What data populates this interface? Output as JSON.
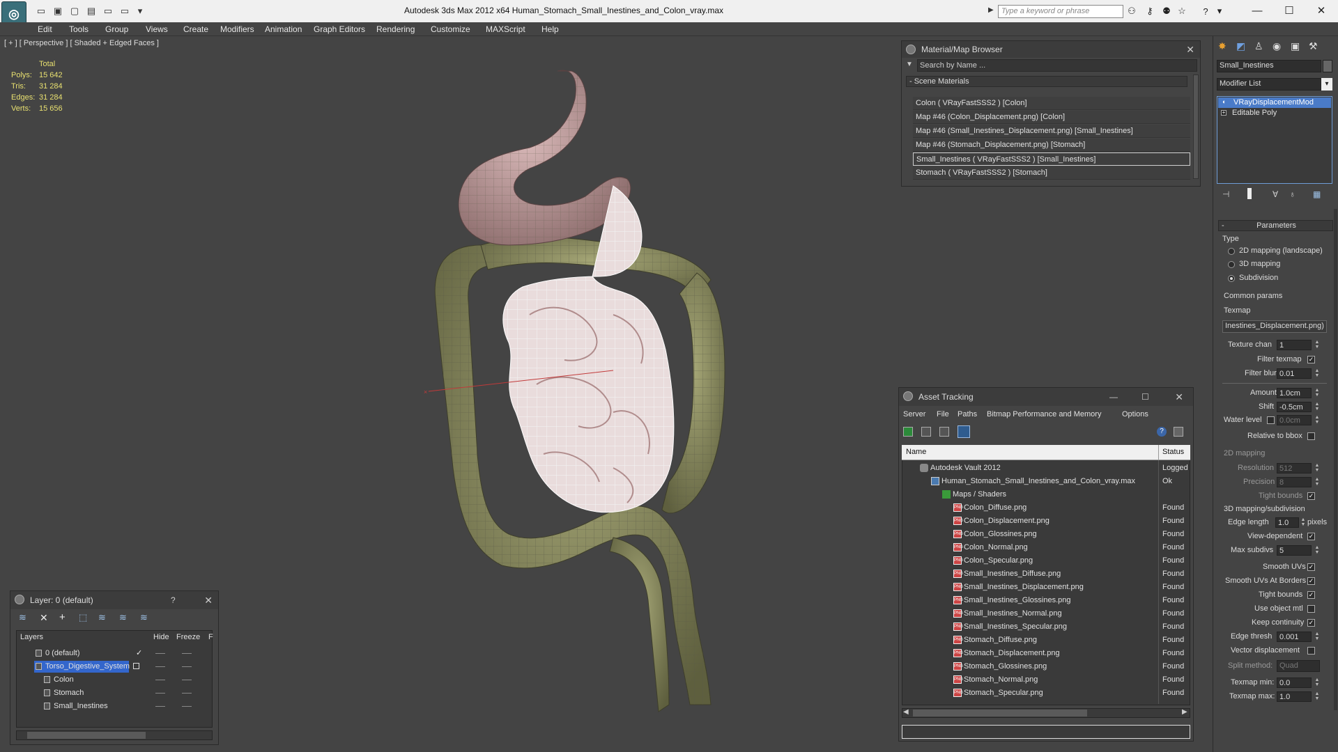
{
  "titlebar": {
    "title": "Autodesk 3ds Max  2012 x64      Human_Stomach_Small_Inestines_and_Colon_vray.max",
    "search_placeholder": "Type a keyword or phrase",
    "minimize": "—",
    "maximize": "☐",
    "close": "✕"
  },
  "menu": [
    "Edit",
    "Tools",
    "Group",
    "Views",
    "Create",
    "Modifiers",
    "Animation",
    "Graph Editors",
    "Rendering",
    "Customize",
    "MAXScript",
    "Help"
  ],
  "viewport": {
    "label": "[ + ] [ Perspective ] [ Shaded + Edged Faces ]",
    "stats_header": "Total",
    "stats": [
      {
        "label": "Polys:",
        "value": "15 642"
      },
      {
        "label": "Tris:",
        "value": "31 284"
      },
      {
        "label": "Edges:",
        "value": "31 284"
      },
      {
        "label": "Verts:",
        "value": "15 656"
      }
    ]
  },
  "material_browser": {
    "title": "Material/Map Browser",
    "search_placeholder": "Search by Name ...",
    "section": "- Scene Materials",
    "items": [
      "Colon  ( VRayFastSSS2 )  [Colon]",
      "Map #46 (Colon_Displacement.png) [Colon]",
      "Map #46 (Small_Inestines_Displacement.png) [Small_Inestines]",
      "Map #46 (Stomach_Displacement.png) [Stomach]",
      "Small_Inestines  ( VRayFastSSS2 )  [Small_Inestines]",
      "Stomach  ( VRayFastSSS2 )  [Stomach]"
    ]
  },
  "asset_tracking": {
    "title": "Asset Tracking",
    "menu": [
      "Server",
      "File",
      "Paths",
      "Bitmap Performance and Memory",
      "Options"
    ],
    "columns": {
      "name": "Name",
      "status": "Status"
    },
    "rows": [
      {
        "name": "Autodesk Vault 2012",
        "status": "Logged",
        "indent": 0,
        "icon": "vault"
      },
      {
        "name": "Human_Stomach_Small_Inestines_and_Colon_vray.max",
        "status": "Ok",
        "indent": 1,
        "icon": "max"
      },
      {
        "name": "Maps / Shaders",
        "status": "",
        "indent": 2,
        "icon": "folder"
      },
      {
        "name": "Colon_Diffuse.png",
        "status": "Found",
        "indent": 3,
        "icon": "png"
      },
      {
        "name": "Colon_Displacement.png",
        "status": "Found",
        "indent": 3,
        "icon": "png"
      },
      {
        "name": "Colon_Glossines.png",
        "status": "Found",
        "indent": 3,
        "icon": "png"
      },
      {
        "name": "Colon_Normal.png",
        "status": "Found",
        "indent": 3,
        "icon": "png"
      },
      {
        "name": "Colon_Specular.png",
        "status": "Found",
        "indent": 3,
        "icon": "png"
      },
      {
        "name": "Small_Inestines_Diffuse.png",
        "status": "Found",
        "indent": 3,
        "icon": "png"
      },
      {
        "name": "Small_Inestines_Displacement.png",
        "status": "Found",
        "indent": 3,
        "icon": "png"
      },
      {
        "name": "Small_Inestines_Glossines.png",
        "status": "Found",
        "indent": 3,
        "icon": "png"
      },
      {
        "name": "Small_Inestines_Normal.png",
        "status": "Found",
        "indent": 3,
        "icon": "png"
      },
      {
        "name": "Small_Inestines_Specular.png",
        "status": "Found",
        "indent": 3,
        "icon": "png"
      },
      {
        "name": "Stomach_Diffuse.png",
        "status": "Found",
        "indent": 3,
        "icon": "png"
      },
      {
        "name": "Stomach_Displacement.png",
        "status": "Found",
        "indent": 3,
        "icon": "png"
      },
      {
        "name": "Stomach_Glossines.png",
        "status": "Found",
        "indent": 3,
        "icon": "png"
      },
      {
        "name": "Stomach_Normal.png",
        "status": "Found",
        "indent": 3,
        "icon": "png"
      },
      {
        "name": "Stomach_Specular.png",
        "status": "Found",
        "indent": 3,
        "icon": "png"
      }
    ]
  },
  "layers": {
    "title": "Layer: 0 (default)",
    "help": "?",
    "columns": [
      "Layers",
      "Hide",
      "Freeze",
      "F"
    ],
    "rows": [
      {
        "name": "0 (default)",
        "indent": 1,
        "selected": false,
        "current": true
      },
      {
        "name": "Torso_Digestive_System",
        "indent": 1,
        "selected": true,
        "current": false
      },
      {
        "name": "Colon",
        "indent": 2,
        "selected": false,
        "current": false
      },
      {
        "name": "Stomach",
        "indent": 2,
        "selected": false,
        "current": false
      },
      {
        "name": "Small_Inestines",
        "indent": 2,
        "selected": false,
        "current": false
      }
    ]
  },
  "command_panel": {
    "object_name": "Small_Inestines",
    "modifier_list": "Modifier List",
    "stack": [
      "VRayDisplacementMod",
      "Editable Poly"
    ],
    "parameters_title": "Parameters",
    "type_label": "Type",
    "type_options": [
      {
        "label": "2D mapping (landscape)",
        "on": false
      },
      {
        "label": "3D mapping",
        "on": false
      },
      {
        "label": "Subdivision",
        "on": true
      }
    ],
    "common_params": "Common params",
    "texmap_label": "Texmap",
    "texmap_value": "Inestines_Displacement.png)",
    "texture_chan_label": "Texture chan",
    "texture_chan": "1",
    "filter_texmap": "Filter texmap",
    "filter_blur_label": "Filter blur",
    "filter_blur": "0.01",
    "amount_label": "Amount",
    "amount": "1.0cm",
    "shift_label": "Shift",
    "shift": "-0.5cm",
    "water_level_label": "Water level",
    "water_level": "0.0cm",
    "relative_bbox": "Relative to bbox",
    "mapping_2d": "2D mapping",
    "resolution_label": "Resolution",
    "resolution": "512",
    "precision_label": "Precision",
    "precision": "8",
    "tight_bounds": "Tight bounds",
    "mapping_3d": "3D mapping/subdivision",
    "edge_length_label": "Edge length",
    "edge_length": "1.0",
    "pixels": "pixels",
    "view_dependent": "View-dependent",
    "max_subdivs_label": "Max subdivs",
    "max_subdivs": "5",
    "smooth_uvs": "Smooth UVs",
    "smooth_uvs_borders": "Smooth UVs At Borders",
    "tight_bounds2": "Tight bounds",
    "use_object_mtl": "Use object mtl",
    "keep_continuity": "Keep continuity",
    "edge_thresh_label": "Edge thresh",
    "edge_thresh": "0.001",
    "vector_disp": "Vector displacement",
    "split_method_label": "Split method:",
    "split_method": "Quad",
    "texmap_min_label": "Texmap min:",
    "texmap_min": "0.0",
    "texmap_max_label": "Texmap max:",
    "texmap_max": "1.0"
  },
  "colors": {
    "accent": "#3366cc",
    "background": "#444444",
    "stats": "#e8e070"
  }
}
